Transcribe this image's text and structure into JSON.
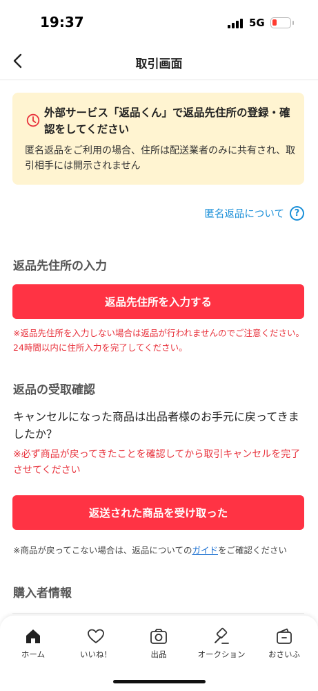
{
  "status_bar": {
    "time": "19:37",
    "network": "5G"
  },
  "nav": {
    "title": "取引画面"
  },
  "notice": {
    "title": "外部サービス「返品くん」で返品先住所の登録・確認をしてください",
    "body": "匿名返品をご利用の場合、住所は配送業者のみに共有され、取引相手には開示されません",
    "accent_color": "#e8323c",
    "background": "#fff4d1"
  },
  "anon_return_link": {
    "label": "匿名返品について",
    "help_symbol": "?"
  },
  "return_address": {
    "heading": "返品先住所の入力",
    "button_label": "返品先住所を入力する",
    "note": "※返品先住所を入力しない場合は返品が行われませんのでご注意ください。24時間以内に住所入力を完了してください。"
  },
  "receipt_confirmation": {
    "heading": "返品の受取確認",
    "question": "キャンセルになった商品は出品者様のお手元に戻ってきましたか？",
    "warning": "※必ず商品が戻ってきたことを確認してから取引キャンセルを完了させてください",
    "button_label": "返送された商品を受け取った",
    "guide_note_prefix": "※商品が戻ってこない場合は、返品についての",
    "guide_link": "ガイド",
    "guide_note_suffix": "をご確認ください"
  },
  "buyer_info": {
    "heading": "購入者情報"
  },
  "tabbar": {
    "items": [
      {
        "label": "ホーム",
        "icon": "home-icon"
      },
      {
        "label": "いいね！",
        "icon": "heart-icon"
      },
      {
        "label": "出品",
        "icon": "camera-icon"
      },
      {
        "label": "オークション",
        "icon": "gavel-icon"
      },
      {
        "label": "おさいふ",
        "icon": "wallet-icon"
      }
    ]
  },
  "colors": {
    "primary": "#ff3344",
    "link": "#1a8fd8",
    "warning": "#e8323c"
  }
}
